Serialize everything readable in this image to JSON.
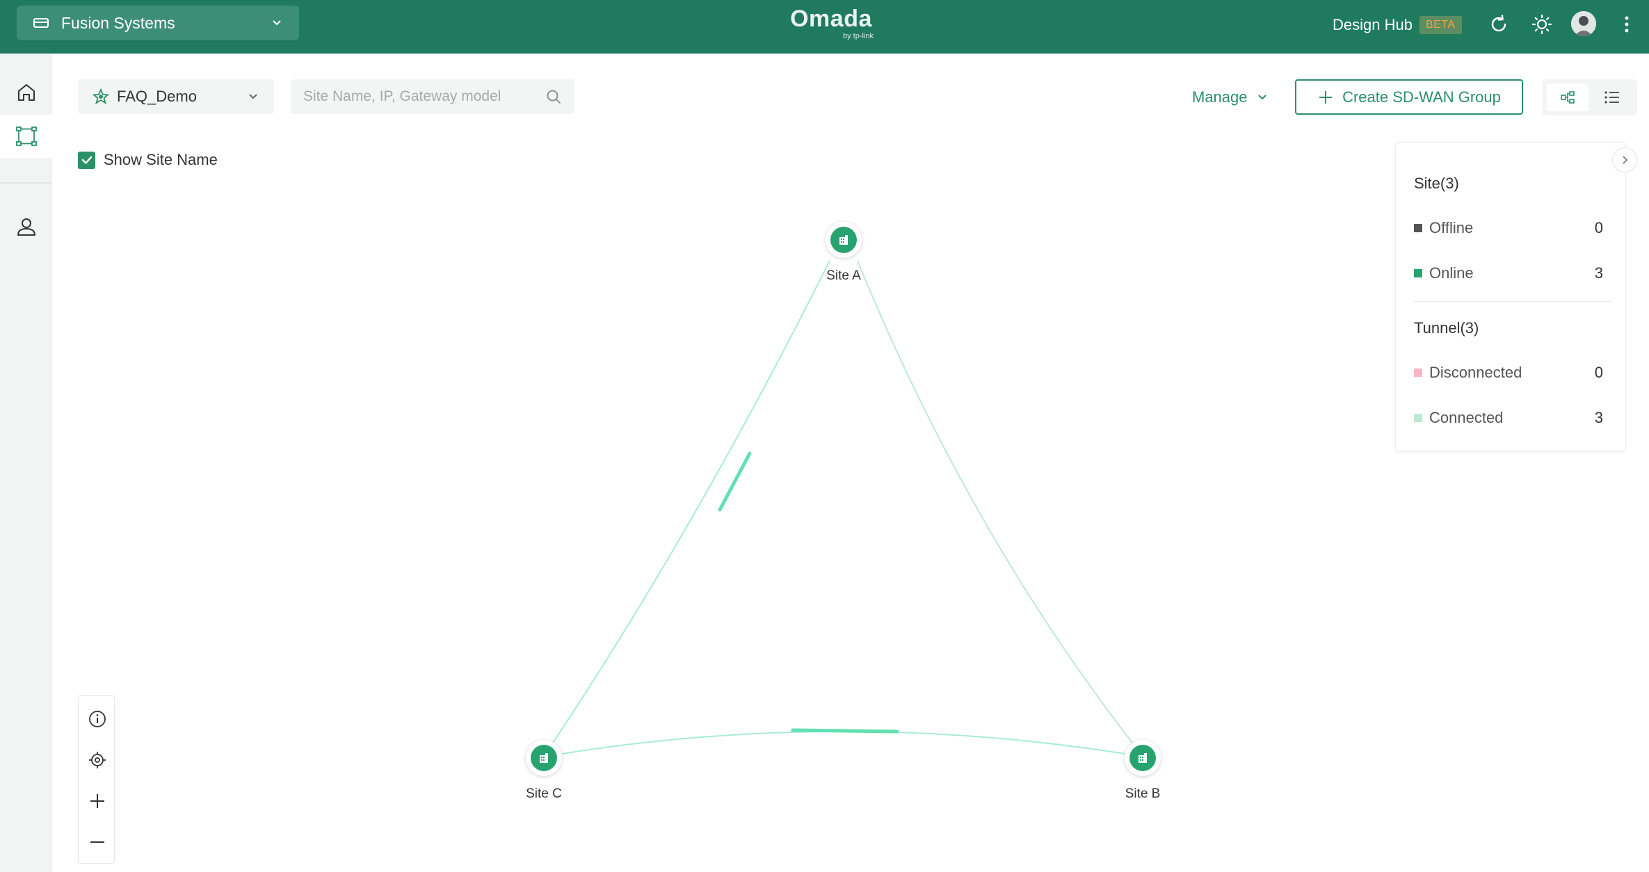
{
  "header": {
    "org_name": "Fusion Systems",
    "logo_main": "Omada",
    "logo_sub": "by tp-link",
    "design_hub": "Design Hub",
    "beta_badge": "BETA"
  },
  "toolbar": {
    "site_group": "FAQ_Demo",
    "search_placeholder": "Site Name, IP, Gateway model",
    "manage_label": "Manage",
    "create_label": "Create SD-WAN Group",
    "show_site_name_label": "Show Site Name"
  },
  "topology": {
    "sites": [
      {
        "name": "Site A",
        "status": "online"
      },
      {
        "name": "Site B",
        "status": "online"
      },
      {
        "name": "Site C",
        "status": "online"
      }
    ],
    "tunnels": [
      {
        "from": "Site A",
        "to": "Site C",
        "status": "connected"
      },
      {
        "from": "Site A",
        "to": "Site B",
        "status": "connected"
      },
      {
        "from": "Site C",
        "to": "Site B",
        "status": "connected"
      }
    ]
  },
  "legend": {
    "site_title": "Site(3)",
    "offline_label": "Offline",
    "offline_count": "0",
    "online_label": "Online",
    "online_count": "3",
    "tunnel_title": "Tunnel(3)",
    "disconnected_label": "Disconnected",
    "disconnected_count": "0",
    "connected_label": "Connected",
    "connected_count": "3"
  },
  "colors": {
    "header_bg": "#1f7a5e",
    "accent": "#2a9168",
    "site_online": "#27a36f",
    "offline": "#555555",
    "disconnected": "#f4b8c4",
    "connected": "#bfe8d6",
    "tunnel_line": "#7ee2be"
  },
  "icons": {
    "org": "router-icon",
    "site_group": "star-network-icon",
    "search": "search-icon",
    "refresh": "refresh-icon",
    "theme": "sun-icon",
    "more": "more-vertical-icon",
    "home": "home-icon",
    "topology": "topology-icon",
    "account": "user-icon",
    "info": "info-icon",
    "locate": "locate-icon",
    "zoom_in": "plus-icon",
    "zoom_out": "minus-icon"
  }
}
